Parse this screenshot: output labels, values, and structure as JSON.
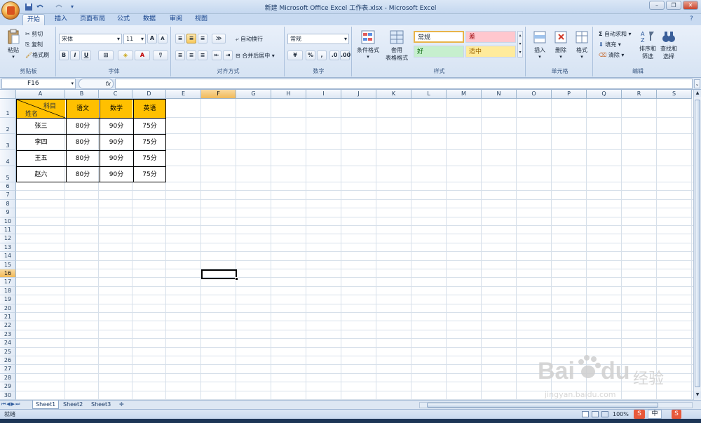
{
  "window": {
    "title": "新建 Microsoft Office Excel 工作表.xlsx - Microsoft Excel",
    "controls": [
      "–",
      "❐",
      "✕"
    ]
  },
  "tabs": [
    "开始",
    "插入",
    "页面布局",
    "公式",
    "数据",
    "审阅",
    "视图"
  ],
  "ribbon": {
    "clipboard": {
      "label": "剪贴板",
      "paste": "粘贴",
      "cut": "剪切",
      "copy": "复制",
      "format_painter": "格式刷"
    },
    "font": {
      "label": "字体",
      "name": "宋体",
      "size": "11",
      "bold": "B",
      "italic": "I",
      "underline": "U"
    },
    "alignment": {
      "label": "对齐方式",
      "wrap": "自动换行",
      "merge": "合并后居中"
    },
    "number": {
      "label": "数字",
      "format": "常规",
      "percent": "%",
      "comma": ","
    },
    "styles": {
      "label": "样式",
      "conditional": "条件格式",
      "table_line1": "套用",
      "table_line2": "表格格式",
      "normal": "常规",
      "bad": "差",
      "good": "好",
      "neutral": "适中"
    },
    "cells": {
      "label": "单元格",
      "insert": "插入",
      "delete": "删除",
      "format": "格式"
    },
    "editing": {
      "label": "编辑",
      "autosum": "自动求和",
      "fill": "填充",
      "clear": "清除",
      "sort_line1": "排序和",
      "sort_line2": "筛选",
      "find_line1": "查找和",
      "find_line2": "选择"
    }
  },
  "formula_bar": {
    "name_box": "F16",
    "fx": "fx",
    "value": ""
  },
  "columns": [
    "A",
    "B",
    "C",
    "D",
    "E",
    "F",
    "G",
    "H",
    "I",
    "J",
    "K",
    "L",
    "M",
    "N",
    "O",
    "P",
    "Q",
    "R",
    "S"
  ],
  "rows": [
    "1",
    "2",
    "3",
    "4",
    "5",
    "6",
    "7",
    "8",
    "9",
    "10",
    "11",
    "12",
    "13",
    "14",
    "15",
    "16",
    "17",
    "18",
    "19",
    "20",
    "21",
    "22",
    "23",
    "24",
    "25",
    "26",
    "27",
    "28",
    "29",
    "30"
  ],
  "table": {
    "header_subject": "科目",
    "header_name": "姓名",
    "headers": [
      "语文",
      "数学",
      "英语"
    ],
    "rows": [
      {
        "name": "张三",
        "scores": [
          "80分",
          "90分",
          "75分"
        ]
      },
      {
        "name": "李四",
        "scores": [
          "80分",
          "90分",
          "75分"
        ]
      },
      {
        "name": "王五",
        "scores": [
          "80分",
          "90分",
          "75分"
        ]
      },
      {
        "name": "赵六",
        "scores": [
          "80分",
          "90分",
          "75分"
        ]
      }
    ]
  },
  "selected_cell": "F16",
  "sheets": [
    "Sheet1",
    "Sheet2",
    "Sheet3"
  ],
  "status": {
    "ready": "就绪",
    "zoom": "100%"
  },
  "watermark": {
    "text1": "Bai",
    "text2": "du",
    "text3": "经验",
    "url": "jingyan.baidu.com"
  },
  "ime": {
    "lang": "中"
  },
  "colors": {
    "header_fill": "#FFC000",
    "selection_orange": "#F1B958",
    "ribbon_blue": "#D6E3F3"
  }
}
